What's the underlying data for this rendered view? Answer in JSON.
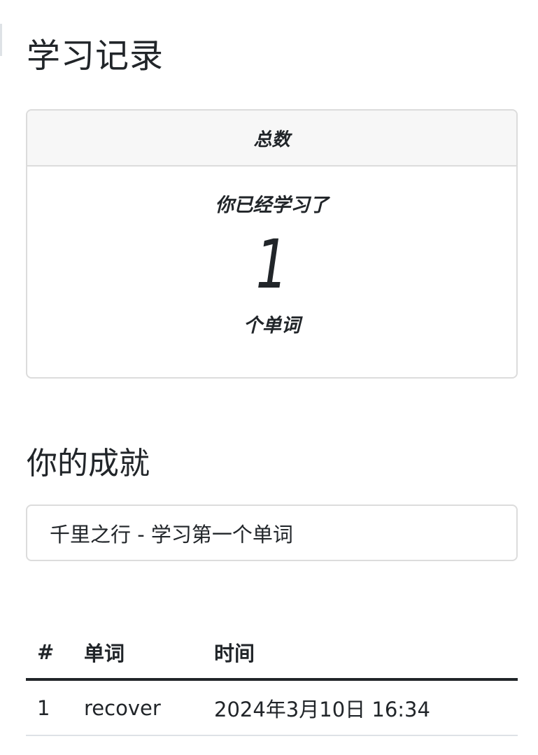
{
  "page": {
    "title": "学习记录"
  },
  "total_card": {
    "header": "总数",
    "line1": "你已经学习了",
    "count": "1",
    "line3": "个单词"
  },
  "achievements": {
    "title": "你的成就",
    "items": [
      {
        "label": "千里之行 - 学习第一个单词"
      }
    ]
  },
  "history_table": {
    "columns": [
      "#",
      "单词",
      "时间"
    ],
    "rows": [
      {
        "index": "1",
        "word": "recover",
        "time": "2024年3月10日 16:34"
      }
    ]
  }
}
